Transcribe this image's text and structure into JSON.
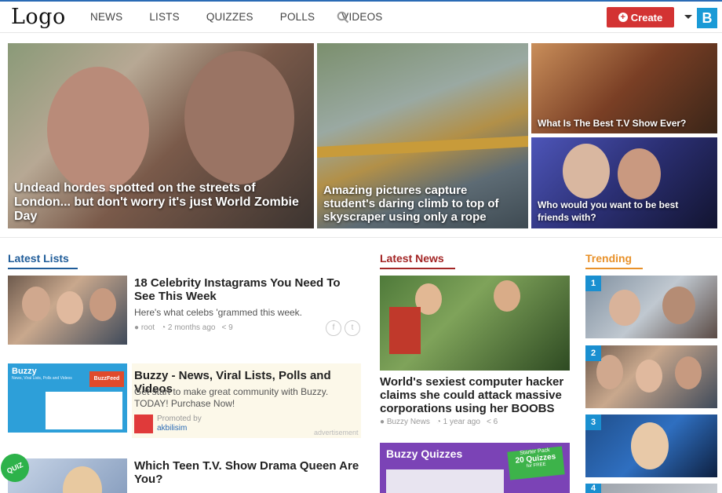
{
  "header": {
    "logo": "Logo",
    "nav": [
      "NEWS",
      "LISTS",
      "QUIZZES",
      "POLLS",
      "VIDEOS"
    ],
    "create_label": "Create",
    "avatar_letter": "B"
  },
  "hero": [
    {
      "caption": "Undead hordes spotted on the streets of London... but don't worry it's just World Zombie Day"
    },
    {
      "caption": "Amazing pictures capture student's daring climb to top of skyscraper using only a rope"
    },
    {
      "caption": "What Is The Best T.V Show Ever?"
    },
    {
      "caption": "Who would you want to be best friends with?"
    }
  ],
  "latest_lists": {
    "title": "Latest Lists",
    "items": [
      {
        "title": "18 Celebrity Instagrams You Need To See This Week",
        "desc": "Here's what celebs 'grammed this week.",
        "author": "root",
        "time": "2 months ago",
        "shares": "9"
      },
      {
        "title": "Buzzy - News, Viral Lists, Polls and Videos",
        "desc": "Get start to make great community with Buzzy. TODAY! Purchase Now!",
        "promoted_by": "Promoted by",
        "promoter": "akbilisim",
        "ad_label": "advertisement",
        "thumb_brand": "Buzzy",
        "thumb_sub": "News, Viral Lists, Polls and Videos",
        "thumb_badge": "BuzzFeed"
      },
      {
        "title": "Which Teen T.V. Show Drama Queen Are You?",
        "badge": "QUIZ"
      }
    ]
  },
  "latest_news": {
    "title": "Latest News",
    "items": [
      {
        "title": "World's sexiest computer hacker claims she could attack massive corporations using her BOOBS",
        "author": "Buzzy News",
        "time": "1 year ago",
        "shares": "6"
      },
      {
        "title": "Buzzy Quizzes",
        "badge_line1": "Starter Pack",
        "badge_line2": "20 Quizzes",
        "badge_line3": "for FREE"
      }
    ]
  },
  "trending": {
    "title": "Trending",
    "ranks": [
      "1",
      "2",
      "3",
      "4"
    ]
  },
  "colors": {
    "accent_blue": "#1a8fd0",
    "create_red": "#d33333",
    "news_red": "#a32525",
    "trending_orange": "#e8912a"
  }
}
